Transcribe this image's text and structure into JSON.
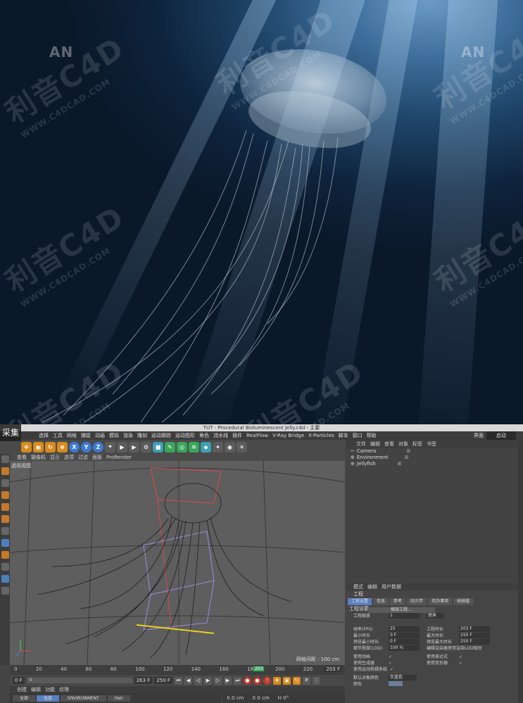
{
  "watermark": {
    "main": "利音C4D",
    "site": "WWW.C4DCAD.COM",
    "logo": "AN"
  },
  "collect_badge": "采集",
  "window_title": "TUT - Procedural Bioluminescent Jelly.c4d - 主要",
  "menu": [
    "文件",
    "编辑",
    "创建",
    "选择",
    "工具",
    "网格",
    "捕捉",
    "动画",
    "模拟",
    "渲染",
    "雕刻",
    "运动跟踪",
    "运动图形",
    "角色",
    "流水线",
    "插件",
    "RealFlow",
    "V-Ray Bridge",
    "X-Particles",
    "脚本",
    "窗口",
    "帮助"
  ],
  "menu_right": {
    "layout_label": "界面",
    "layout_value": "启动"
  },
  "toolbar_letters": [
    "X",
    "Y",
    "Z"
  ],
  "viewport_menu": [
    "查看",
    "摄像机",
    "显示",
    "选项",
    "过滤",
    "面板",
    "ProRender"
  ],
  "viewport_label": "透视视图",
  "grid_spacing": "网格间距 : 100 cm",
  "timeline_ticks": [
    "0",
    "20",
    "40",
    "60",
    "80",
    "100",
    "120",
    "140",
    "160",
    "180",
    "200",
    "220",
    "240"
  ],
  "current_frame_marker": "203",
  "timeline_end": "203 F",
  "playbar": {
    "start": "0 F",
    "slider_val": "0",
    "min": "263 F",
    "max": "250 F"
  },
  "bottom_menu": [
    "创建",
    "编辑",
    "功能",
    "纹理"
  ],
  "bottom_tabs": [
    "全部",
    "无层",
    "ENVIRONMENT",
    "Hair"
  ],
  "coords": [
    "X 0 cm",
    "X 0 cm",
    "H 0°"
  ],
  "object_menu": [
    "文件",
    "编辑",
    "查看",
    "对象",
    "标签",
    "书签"
  ],
  "objects": [
    {
      "name": "Camera",
      "tag": "⊞"
    },
    {
      "name": "Environment",
      "tag": "⊞"
    },
    {
      "name": "Jellyfish",
      "tag": "⊞"
    }
  ],
  "attr_menu": [
    "模式",
    "编辑",
    "用户数据"
  ],
  "attr_title": "工程",
  "attr_tabs": [
    "工程设置",
    "信息",
    "参考",
    "动力学",
    "待办事项",
    "帧插值"
  ],
  "section_title": "工程设置",
  "project_scale": {
    "label": "工程缩放",
    "value": "1",
    "unit": "厘米"
  },
  "scale_button": "缩放工程...",
  "fields": [
    {
      "l1": "帧率(FPS)",
      "v1": "25",
      "l2": "工程时长",
      "v2": "203 F"
    },
    {
      "l1": "最小时长",
      "v1": "0 F",
      "l2": "最大时长",
      "v2": "250 F"
    },
    {
      "l1": "预览最小时长",
      "v1": "0 F",
      "l2": "预览最大时长",
      "v2": "250 F"
    },
    {
      "l1": "细节程度(LOD)",
      "v1": "100 %",
      "l2": "编辑渲染器使用渲染LOD级别",
      "v2": ""
    }
  ],
  "checks": [
    {
      "l1": "使用动画",
      "l2": "使用表达式"
    },
    {
      "l1": "使用生成器",
      "l2": "使用变形器"
    },
    {
      "l1": "使用运动剪辑系统",
      "l2": ""
    }
  ],
  "default_color": {
    "label": "默认对象颜色",
    "value": "灰蓝色"
  },
  "color_label": "颜色"
}
